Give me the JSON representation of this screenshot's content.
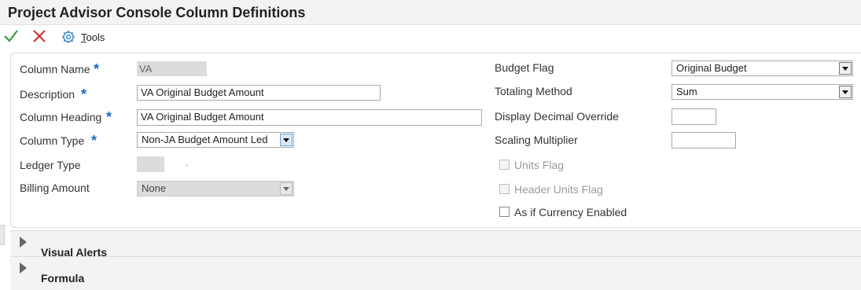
{
  "page_title": "Project Advisor Console Column Definitions",
  "toolbar": {
    "ok_icon": "checkmark-icon",
    "cancel_icon": "close-icon",
    "tools_icon": "gear-icon",
    "tools_label_accel": "T",
    "tools_label_rest": "ools"
  },
  "form": {
    "column_name": {
      "label": "Column Name",
      "value": "VA",
      "required": "*"
    },
    "description": {
      "label": "Description",
      "value": "VA Original Budget Amount",
      "required": "*"
    },
    "column_heading": {
      "label": "Column Heading",
      "value": "VA Original Budget Amount",
      "required": "*"
    },
    "column_type": {
      "label": "Column Type",
      "value": "Non-JA Budget Amount Led",
      "required": "*"
    },
    "ledger_type": {
      "label": "Ledger Type",
      "value": "",
      "desc": "."
    },
    "billing_amount": {
      "label": "Billing Amount",
      "value": "None"
    },
    "budget_flag": {
      "label": "Budget Flag",
      "value": "Original Budget"
    },
    "totaling_method": {
      "label": "Totaling Method",
      "value": "Sum"
    },
    "display_decimal_override": {
      "label": "Display Decimal Override",
      "value": ""
    },
    "scaling_multiplier": {
      "label": "Scaling Multiplier",
      "value": ""
    },
    "units_flag": {
      "label": "Units Flag",
      "checked": false
    },
    "header_units_flag": {
      "label": "Header Units Flag",
      "checked": false
    },
    "as_if_currency_enabled": {
      "label": "As if Currency Enabled",
      "checked": false
    }
  },
  "sections": [
    {
      "title": "Visual Alerts",
      "expanded": false
    },
    {
      "title": "Formula",
      "expanded": false
    }
  ],
  "colors": {
    "required_star": "#1b6ac9",
    "ok_green": "#2e9e3a",
    "cancel_red": "#d42a2a",
    "tools_blue": "#3a86c8"
  }
}
